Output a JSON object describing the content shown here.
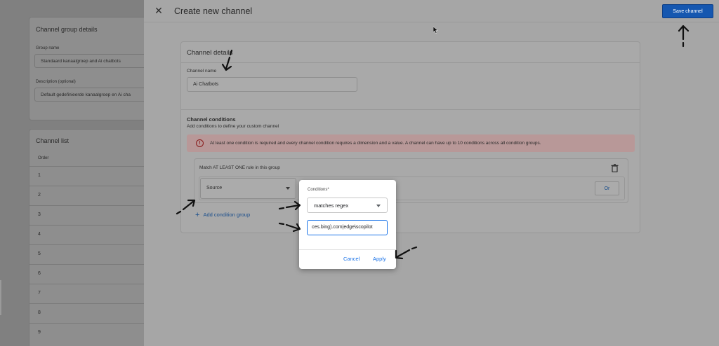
{
  "background_page": {
    "group_details_title": "Channel group details",
    "group_name_label": "Group name",
    "group_name_value": "Standaard kanaalgroep and Ai chatbots",
    "description_label": "Description (optional)",
    "description_value": "Default gedefinieerde kanaalgroep en Ai cha",
    "channel_list_title": "Channel list",
    "order_header": "Order",
    "rows": [
      "1",
      "2",
      "3",
      "4",
      "5",
      "6",
      "7",
      "8",
      "9"
    ]
  },
  "panel": {
    "title": "Create new channel",
    "save_label": "Save channel"
  },
  "channel_details": {
    "title": "Channel details",
    "name_label": "Channel name",
    "name_value": "Ai Chatbots",
    "conditions_title": "Channel conditions",
    "conditions_subtitle": "Add conditions to define your custom channel",
    "error_text": "At least one condition is required and every channel condition requires a dimension and a value. A channel can have up to 10 conditions across all condition groups.",
    "group_rule_label": "Match AT LEAST ONE rule in this group",
    "dimension_value": "Source",
    "or_label": "Or",
    "add_group_label": "Add condition group"
  },
  "popup": {
    "label": "Conditions*",
    "operator_value": "matches regex",
    "value_input": "ces.bing).com|edge\\scopilot",
    "cancel_label": "Cancel",
    "apply_label": "Apply"
  },
  "colors": {
    "primary": "#1a73e8",
    "save_button": "#1557b0",
    "error": "#d93025"
  }
}
